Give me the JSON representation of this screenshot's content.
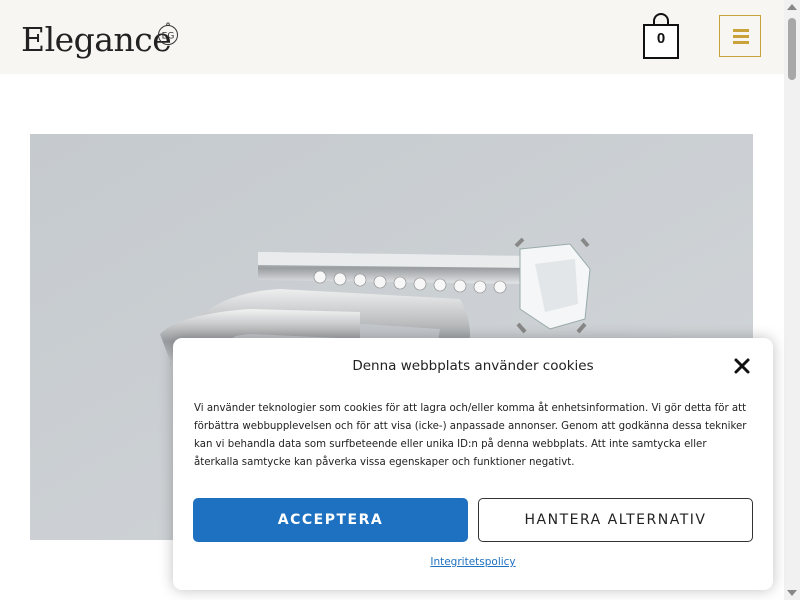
{
  "header": {
    "logo_text": "Elegance",
    "logo_badge": "EG",
    "cart_count": "0",
    "menu_icon": "hamburger-icon",
    "accent_color": "#c9a23a",
    "background_color": "#f8f6f3"
  },
  "hero": {
    "image_subject": "engagement-ring-image"
  },
  "cookie_banner": {
    "title": "Denna webbplats använder cookies",
    "body": "Vi använder teknologier som cookies för att lagra och/eller komma åt enhetsinformation. Vi gör detta för att förbättra webbupplevelsen och för att visa (icke-) anpassade annonser. Genom att godkänna dessa tekniker kan vi behandla data som surfbeteende eller unika ID:n på denna webbplats. Att inte samtycka eller återkalla samtycke kan påverka vissa egenskaper och funktioner negativt.",
    "accept_label": "ACCEPTERA",
    "manage_label": "HANTERA ALTERNATIV",
    "policy_link": "Integritetspolicy",
    "accent_color": "#1e71c0"
  }
}
